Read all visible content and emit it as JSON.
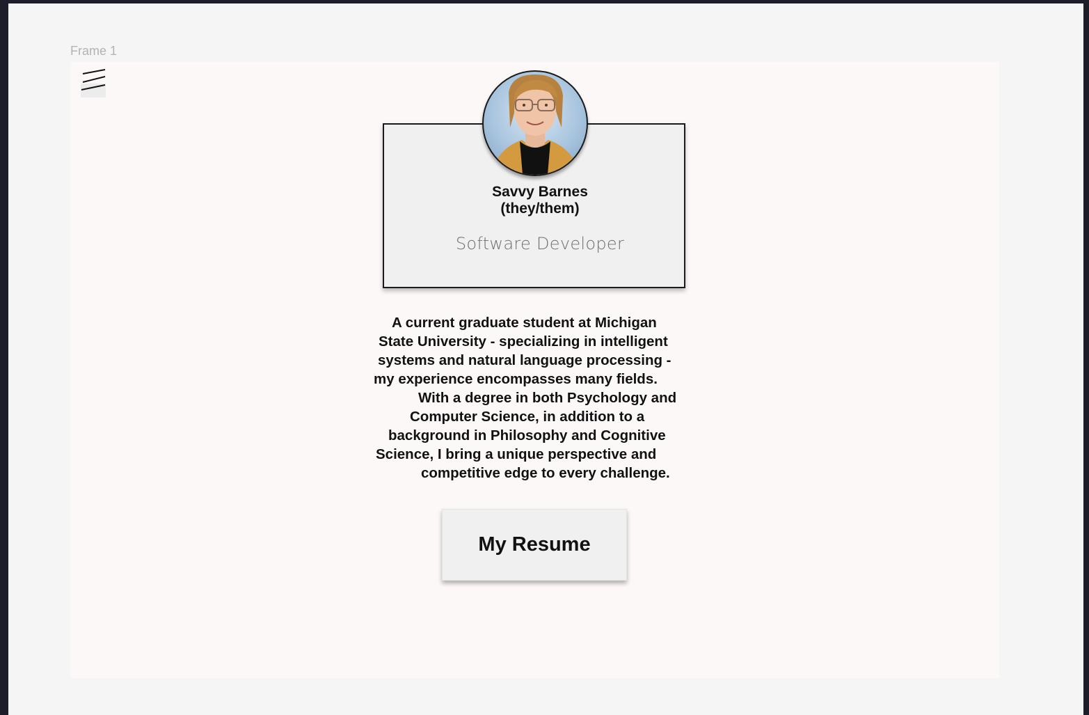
{
  "frame": {
    "label": "Frame 1"
  },
  "nav": {
    "menu_icon": "hamburger-menu-icon"
  },
  "profile": {
    "avatar_alt": "Savvy Barnes",
    "name": "Savvy Barnes",
    "pronouns": "(they/them)",
    "role": "Software Developer"
  },
  "bio": {
    "lines": [
      "A current graduate student at Michigan",
      "State University - specializing in intelligent",
      "systems and natural language processing -",
      "my experience encompasses many fields.",
      "With a degree in both Psychology and",
      "Computer Science, in addition to a",
      "background in Philosophy and Cognitive",
      "Science, I bring a unique perspective and",
      "competitive edge to every challenge."
    ]
  },
  "actions": {
    "resume_label": "My Resume"
  },
  "colors": {
    "app_background": "#1e1e2b",
    "canvas": "#f5f5f5",
    "frame": "#fdf8f8",
    "card": "#f0f0f0",
    "border": "#1a1a1a"
  }
}
